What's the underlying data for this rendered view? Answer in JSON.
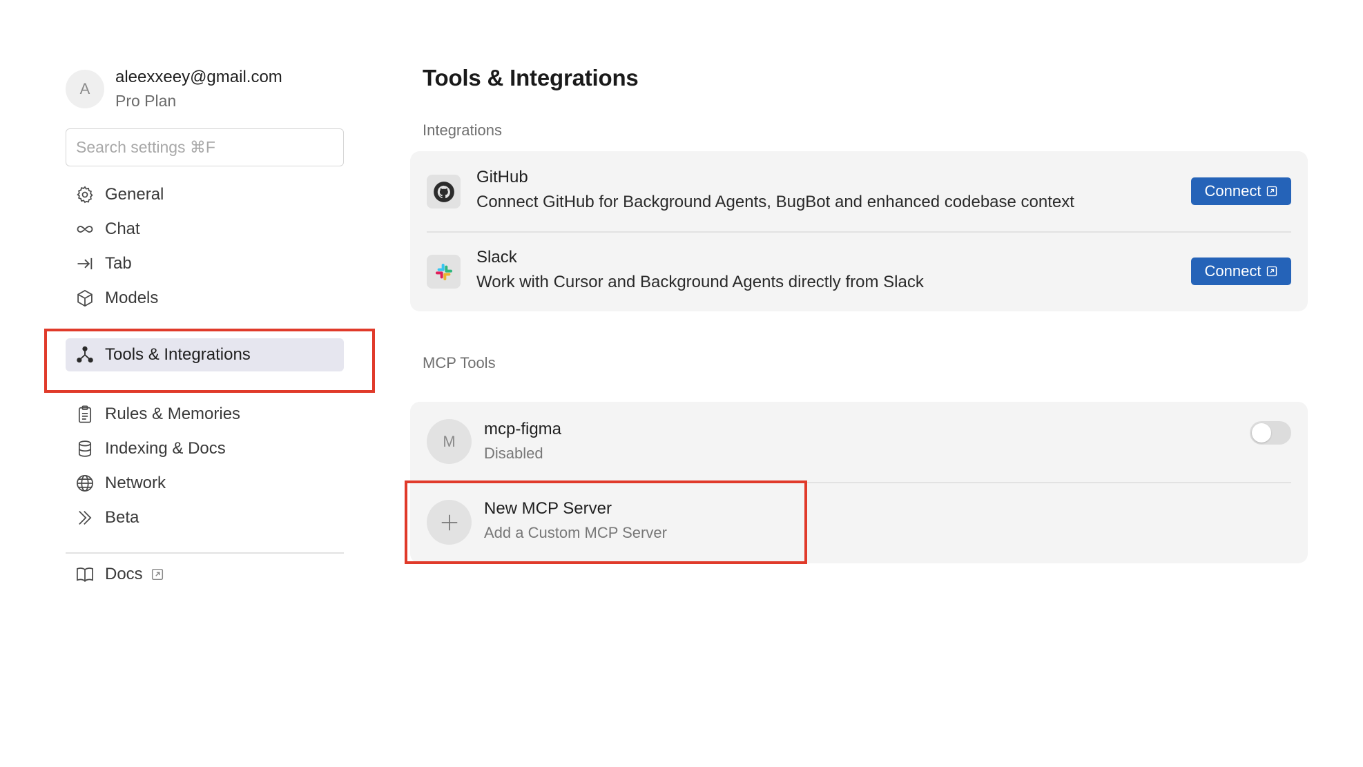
{
  "user": {
    "avatar_letter": "A",
    "email": "aleexxeey@gmail.com",
    "plan": "Pro Plan"
  },
  "search": {
    "placeholder": "Search settings ⌘F"
  },
  "nav": {
    "items": [
      {
        "label": "General",
        "icon": "gear-icon"
      },
      {
        "label": "Chat",
        "icon": "infinity-icon"
      },
      {
        "label": "Tab",
        "icon": "tab-arrow-icon"
      },
      {
        "label": "Models",
        "icon": "cube-icon"
      },
      {
        "label": "Tools & Integrations",
        "icon": "nodes-icon",
        "active": true
      },
      {
        "label": "Rules & Memories",
        "icon": "clipboard-icon"
      },
      {
        "label": "Indexing & Docs",
        "icon": "database-icon"
      },
      {
        "label": "Network",
        "icon": "globe-icon"
      },
      {
        "label": "Beta",
        "icon": "chevrons-right-icon"
      },
      {
        "label": "Docs",
        "icon": "book-icon",
        "external": true
      }
    ]
  },
  "main": {
    "title": "Tools & Integrations",
    "integrations": {
      "label": "Integrations",
      "items": [
        {
          "name": "GitHub",
          "description": "Connect GitHub for Background Agents, BugBot and enhanced codebase context",
          "button": "Connect",
          "icon": "github-icon"
        },
        {
          "name": "Slack",
          "description": "Work with Cursor and Background Agents directly from Slack",
          "button": "Connect",
          "icon": "slack-icon"
        }
      ]
    },
    "mcp": {
      "label": "MCP Tools",
      "servers": [
        {
          "avatar_letter": "M",
          "name": "mcp-figma",
          "status": "Disabled",
          "enabled": false
        }
      ],
      "new_server": {
        "title": "New MCP Server",
        "subtitle": "Add a Custom MCP Server",
        "icon": "plus-icon"
      }
    }
  },
  "colors": {
    "accent": "#2563b8",
    "highlight": "#e03a2a",
    "active_nav_bg": "#e6e6ef",
    "card_bg": "#f4f4f4"
  }
}
